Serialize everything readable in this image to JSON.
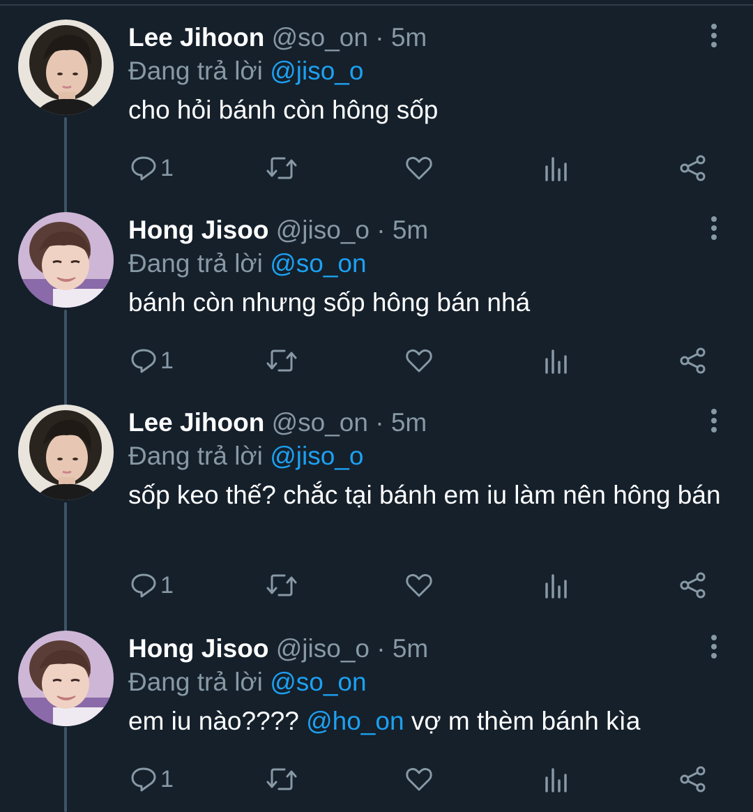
{
  "labels": {
    "replying_prefix": "Đang trả lời",
    "time_sep": "·"
  },
  "tweets": [
    {
      "name": "Lee Jihoon",
      "handle": "@so_on",
      "time": "5m",
      "replying_to": "@jiso_o",
      "text_before": "cho hỏi bánh còn hông sốp",
      "text_mention": "",
      "text_after": "",
      "reply_count": "1",
      "avatar": "lee-jihoon"
    },
    {
      "name": "Hong Jisoo",
      "handle": "@jiso_o",
      "time": "5m",
      "replying_to": "@so_on",
      "text_before": "bánh còn nhưng sốp hông bán nhá",
      "text_mention": "",
      "text_after": "",
      "reply_count": "1",
      "avatar": "hong-jisoo"
    },
    {
      "name": "Lee Jihoon",
      "handle": "@so_on",
      "time": "5m",
      "replying_to": "@jiso_o",
      "text_before": "sốp keo thế? chắc tại bánh em iu làm nên hông bán",
      "text_mention": "",
      "text_after": "",
      "reply_count": "1",
      "avatar": "lee-jihoon"
    },
    {
      "name": "Hong Jisoo",
      "handle": "@jiso_o",
      "time": "5m",
      "replying_to": "@so_on",
      "text_before": "em iu nào???? ",
      "text_mention": "@ho_on",
      "text_after": " vợ m thèm bánh kìa",
      "reply_count": "1",
      "avatar": "hong-jisoo"
    }
  ],
  "colors": {
    "background": "#15202b",
    "name": "#ffffff",
    "secondary": "#8899a6",
    "mention": "#1da1f2",
    "thread_line": "#3d5466"
  },
  "icons": [
    "reply-icon",
    "retweet-icon",
    "like-icon",
    "analytics-icon",
    "share-icon",
    "more-options-icon"
  ]
}
